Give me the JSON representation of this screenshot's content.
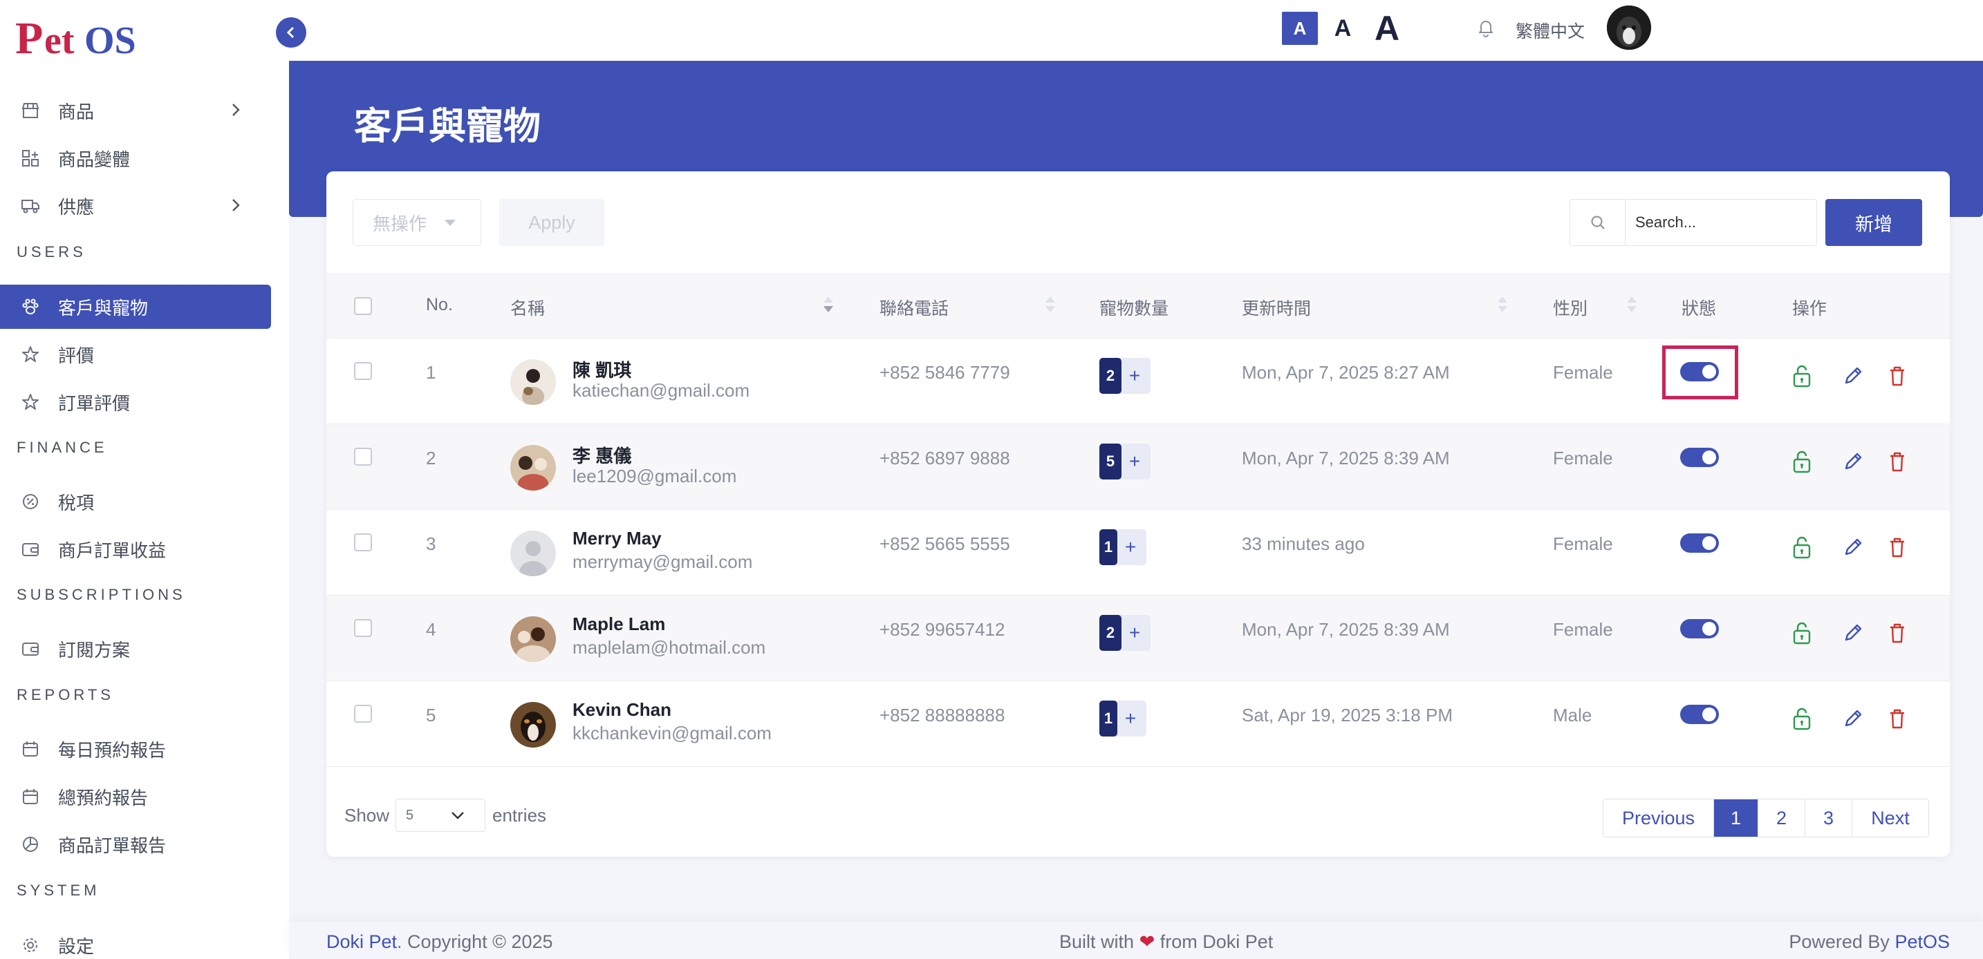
{
  "app": {
    "logo_text": "PetOS"
  },
  "sidebar": {
    "items": [
      {
        "label": "商品",
        "icon": "store-icon",
        "has_chevron": true
      },
      {
        "label": "商品變體",
        "icon": "variants-icon",
        "has_chevron": false
      },
      {
        "label": "供應",
        "icon": "truck-icon",
        "has_chevron": true
      }
    ],
    "section_users": "USERS",
    "users_items": [
      {
        "label": "客戶與寵物",
        "icon": "paw-icon",
        "active": true
      },
      {
        "label": "評價",
        "icon": "star-icon"
      },
      {
        "label": "訂單評價",
        "icon": "star-icon"
      }
    ],
    "section_finance": "FINANCE",
    "finance_items": [
      {
        "label": "稅項",
        "icon": "tax-icon"
      },
      {
        "label": "商戶訂單收益",
        "icon": "wallet-icon"
      }
    ],
    "section_subscriptions": "SUBSCRIPTIONS",
    "subscriptions_items": [
      {
        "label": "訂閱方案",
        "icon": "wallet-icon"
      }
    ],
    "section_reports": "REPORTS",
    "reports_items": [
      {
        "label": "每日預約報告",
        "icon": "calendar-icon"
      },
      {
        "label": "總預約報告",
        "icon": "calendar-icon"
      },
      {
        "label": "商品訂單報告",
        "icon": "pie-chart-icon"
      }
    ],
    "section_system": "SYSTEM",
    "system_items": [
      {
        "label": "設定",
        "icon": "gear-icon"
      }
    ]
  },
  "topbar": {
    "font_small": "A",
    "font_medium": "A",
    "font_large": "A",
    "language": "繁體中文"
  },
  "page": {
    "title": "客戶與寵物"
  },
  "toolbar": {
    "bulk_action": "無操作",
    "apply_label": "Apply",
    "search_placeholder": "Search...",
    "add_label": "新增"
  },
  "table": {
    "columns": [
      "No.",
      "名稱",
      "聯絡電話",
      "寵物數量",
      "更新時間",
      "性別",
      "狀態",
      "操作"
    ],
    "rows": [
      {
        "no": "1",
        "name": "陳 凱琪",
        "email": "katiechan@gmail.com",
        "phone": "+852 5846 7779",
        "pets": "2",
        "updated": "Mon, Apr 7, 2025 8:27 AM",
        "gender": "Female",
        "status": true
      },
      {
        "no": "2",
        "name": "李 惠儀",
        "email": "lee1209@gmail.com",
        "phone": "+852 6897 9888",
        "pets": "5",
        "updated": "Mon, Apr 7, 2025 8:39 AM",
        "gender": "Female",
        "status": true
      },
      {
        "no": "3",
        "name": "Merry May",
        "email": "merrymay@gmail.com",
        "phone": "+852 5665 5555",
        "pets": "1",
        "updated": "33 minutes ago",
        "gender": "Female",
        "status": true
      },
      {
        "no": "4",
        "name": "Maple Lam",
        "email": "maplelam@hotmail.com",
        "phone": "+852 99657412",
        "pets": "2",
        "updated": "Mon, Apr 7, 2025 8:39 AM",
        "gender": "Female",
        "status": true
      },
      {
        "no": "5",
        "name": "Kevin Chan",
        "email": "kkchankevin@gmail.com",
        "phone": "+852 88888888",
        "pets": "1",
        "updated": "Sat, Apr 19, 2025 3:18 PM",
        "gender": "Male",
        "status": true
      }
    ],
    "plus": "+"
  },
  "pagination": {
    "show_label": "Show",
    "entries_value": "5",
    "entries_label": "entries",
    "previous": "Previous",
    "pages": [
      "1",
      "2",
      "3"
    ],
    "current": "1",
    "next": "Next"
  },
  "footer": {
    "left_brand": "Doki Pet",
    "left_text": ". Copyright © 2025",
    "mid_prefix": "Built with",
    "mid_suffix": "from Doki Pet",
    "right_prefix": "Powered By",
    "right_brand": "PetOS"
  },
  "colors": {
    "primary": "#3f51b5",
    "logo_red": "#c8244a",
    "highlight": "#c8245a",
    "lock_green": "#2e9a4e",
    "delete_red": "#d0342c"
  }
}
